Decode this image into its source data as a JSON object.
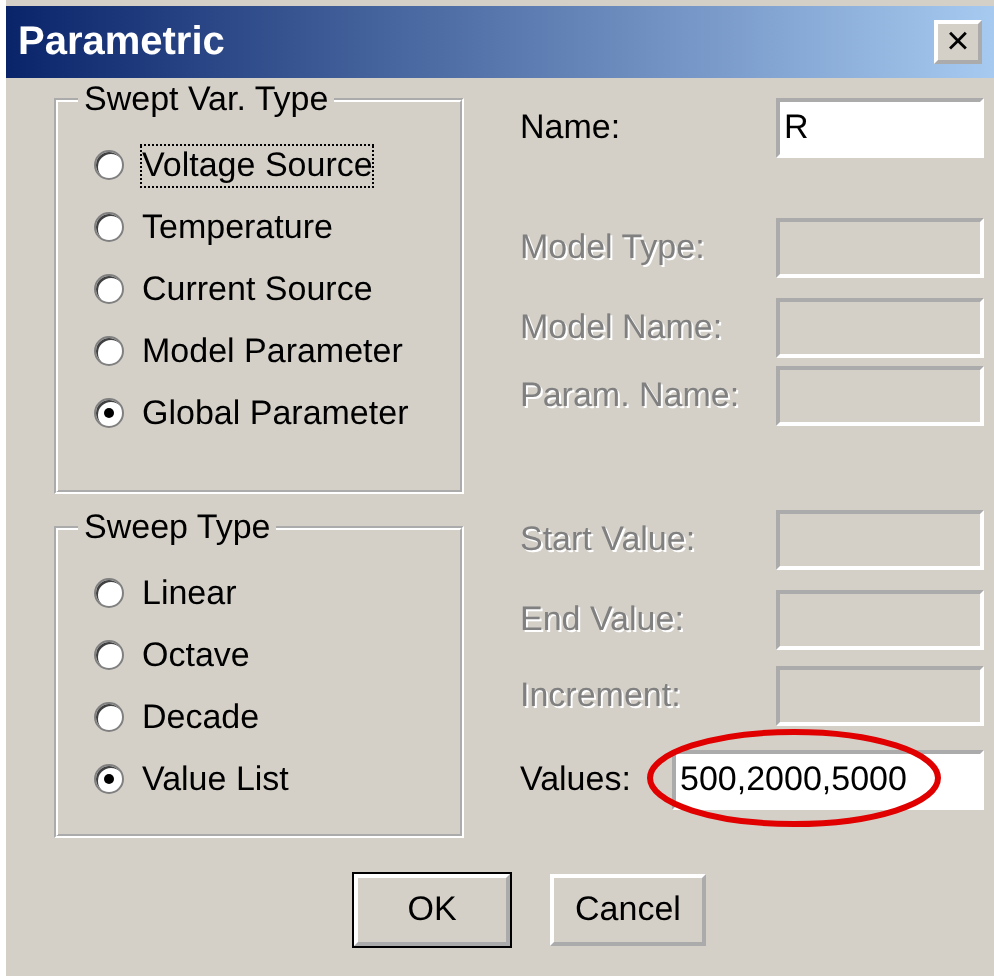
{
  "window": {
    "title": "Parametric",
    "close": "×"
  },
  "swept_var_type": {
    "title": "Swept Var. Type",
    "options": [
      {
        "label": "Voltage Source",
        "selected": false,
        "focused": true
      },
      {
        "label": "Temperature",
        "selected": false,
        "focused": false
      },
      {
        "label": "Current Source",
        "selected": false,
        "focused": false
      },
      {
        "label": "Model Parameter",
        "selected": false,
        "focused": false
      },
      {
        "label": "Global Parameter",
        "selected": true,
        "focused": false
      }
    ]
  },
  "sweep_type": {
    "title": "Sweep Type",
    "options": [
      {
        "label": "Linear",
        "selected": false,
        "focused": false
      },
      {
        "label": "Octave",
        "selected": false,
        "focused": false
      },
      {
        "label": "Decade",
        "selected": false,
        "focused": false
      },
      {
        "label": "Value List",
        "selected": true,
        "focused": false
      }
    ]
  },
  "fields": [
    {
      "label": "Name:",
      "value": "R",
      "disabled": false,
      "circled": false
    },
    {
      "label": "Model Type:",
      "disabled": true,
      "circled": false
    },
    {
      "label": "Model Name:",
      "disabled": true,
      "circled": false
    },
    {
      "label": "Param. Name:",
      "disabled": true,
      "circled": false
    },
    {
      "label": "Start Value:",
      "disabled": true,
      "circled": false
    },
    {
      "label": "End Value:",
      "disabled": true,
      "circled": false
    },
    {
      "label": "Increment:",
      "disabled": true,
      "circled": false
    },
    {
      "label": "Values:",
      "value": "500,2000,5000",
      "disabled": false,
      "circled": true
    }
  ],
  "buttons": [
    {
      "label": "OK",
      "default": true
    },
    {
      "label": "Cancel",
      "default": false
    }
  ]
}
